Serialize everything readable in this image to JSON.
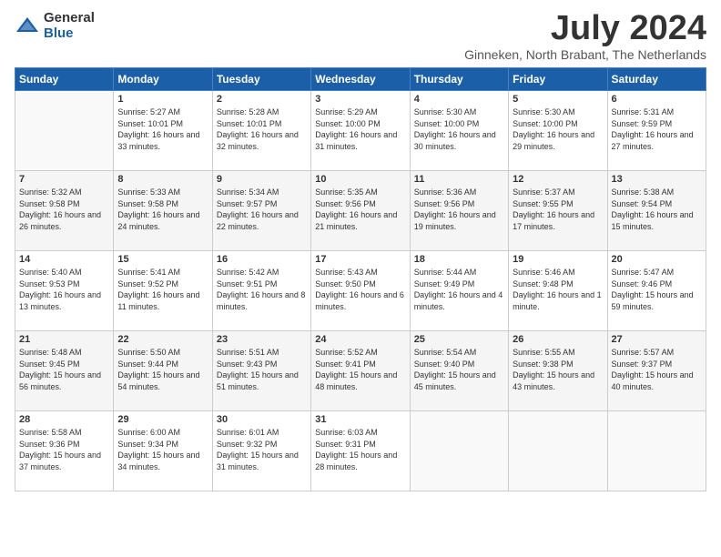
{
  "logo": {
    "general": "General",
    "blue": "Blue"
  },
  "title": "July 2024",
  "subtitle": "Ginneken, North Brabant, The Netherlands",
  "days_of_week": [
    "Sunday",
    "Monday",
    "Tuesday",
    "Wednesday",
    "Thursday",
    "Friday",
    "Saturday"
  ],
  "weeks": [
    [
      {
        "day": "",
        "sunrise": "",
        "sunset": "",
        "daylight": ""
      },
      {
        "day": "1",
        "sunrise": "Sunrise: 5:27 AM",
        "sunset": "Sunset: 10:01 PM",
        "daylight": "Daylight: 16 hours and 33 minutes."
      },
      {
        "day": "2",
        "sunrise": "Sunrise: 5:28 AM",
        "sunset": "Sunset: 10:01 PM",
        "daylight": "Daylight: 16 hours and 32 minutes."
      },
      {
        "day": "3",
        "sunrise": "Sunrise: 5:29 AM",
        "sunset": "Sunset: 10:00 PM",
        "daylight": "Daylight: 16 hours and 31 minutes."
      },
      {
        "day": "4",
        "sunrise": "Sunrise: 5:30 AM",
        "sunset": "Sunset: 10:00 PM",
        "daylight": "Daylight: 16 hours and 30 minutes."
      },
      {
        "day": "5",
        "sunrise": "Sunrise: 5:30 AM",
        "sunset": "Sunset: 10:00 PM",
        "daylight": "Daylight: 16 hours and 29 minutes."
      },
      {
        "day": "6",
        "sunrise": "Sunrise: 5:31 AM",
        "sunset": "Sunset: 9:59 PM",
        "daylight": "Daylight: 16 hours and 27 minutes."
      }
    ],
    [
      {
        "day": "7",
        "sunrise": "Sunrise: 5:32 AM",
        "sunset": "Sunset: 9:58 PM",
        "daylight": "Daylight: 16 hours and 26 minutes."
      },
      {
        "day": "8",
        "sunrise": "Sunrise: 5:33 AM",
        "sunset": "Sunset: 9:58 PM",
        "daylight": "Daylight: 16 hours and 24 minutes."
      },
      {
        "day": "9",
        "sunrise": "Sunrise: 5:34 AM",
        "sunset": "Sunset: 9:57 PM",
        "daylight": "Daylight: 16 hours and 22 minutes."
      },
      {
        "day": "10",
        "sunrise": "Sunrise: 5:35 AM",
        "sunset": "Sunset: 9:56 PM",
        "daylight": "Daylight: 16 hours and 21 minutes."
      },
      {
        "day": "11",
        "sunrise": "Sunrise: 5:36 AM",
        "sunset": "Sunset: 9:56 PM",
        "daylight": "Daylight: 16 hours and 19 minutes."
      },
      {
        "day": "12",
        "sunrise": "Sunrise: 5:37 AM",
        "sunset": "Sunset: 9:55 PM",
        "daylight": "Daylight: 16 hours and 17 minutes."
      },
      {
        "day": "13",
        "sunrise": "Sunrise: 5:38 AM",
        "sunset": "Sunset: 9:54 PM",
        "daylight": "Daylight: 16 hours and 15 minutes."
      }
    ],
    [
      {
        "day": "14",
        "sunrise": "Sunrise: 5:40 AM",
        "sunset": "Sunset: 9:53 PM",
        "daylight": "Daylight: 16 hours and 13 minutes."
      },
      {
        "day": "15",
        "sunrise": "Sunrise: 5:41 AM",
        "sunset": "Sunset: 9:52 PM",
        "daylight": "Daylight: 16 hours and 11 minutes."
      },
      {
        "day": "16",
        "sunrise": "Sunrise: 5:42 AM",
        "sunset": "Sunset: 9:51 PM",
        "daylight": "Daylight: 16 hours and 8 minutes."
      },
      {
        "day": "17",
        "sunrise": "Sunrise: 5:43 AM",
        "sunset": "Sunset: 9:50 PM",
        "daylight": "Daylight: 16 hours and 6 minutes."
      },
      {
        "day": "18",
        "sunrise": "Sunrise: 5:44 AM",
        "sunset": "Sunset: 9:49 PM",
        "daylight": "Daylight: 16 hours and 4 minutes."
      },
      {
        "day": "19",
        "sunrise": "Sunrise: 5:46 AM",
        "sunset": "Sunset: 9:48 PM",
        "daylight": "Daylight: 16 hours and 1 minute."
      },
      {
        "day": "20",
        "sunrise": "Sunrise: 5:47 AM",
        "sunset": "Sunset: 9:46 PM",
        "daylight": "Daylight: 15 hours and 59 minutes."
      }
    ],
    [
      {
        "day": "21",
        "sunrise": "Sunrise: 5:48 AM",
        "sunset": "Sunset: 9:45 PM",
        "daylight": "Daylight: 15 hours and 56 minutes."
      },
      {
        "day": "22",
        "sunrise": "Sunrise: 5:50 AM",
        "sunset": "Sunset: 9:44 PM",
        "daylight": "Daylight: 15 hours and 54 minutes."
      },
      {
        "day": "23",
        "sunrise": "Sunrise: 5:51 AM",
        "sunset": "Sunset: 9:43 PM",
        "daylight": "Daylight: 15 hours and 51 minutes."
      },
      {
        "day": "24",
        "sunrise": "Sunrise: 5:52 AM",
        "sunset": "Sunset: 9:41 PM",
        "daylight": "Daylight: 15 hours and 48 minutes."
      },
      {
        "day": "25",
        "sunrise": "Sunrise: 5:54 AM",
        "sunset": "Sunset: 9:40 PM",
        "daylight": "Daylight: 15 hours and 45 minutes."
      },
      {
        "day": "26",
        "sunrise": "Sunrise: 5:55 AM",
        "sunset": "Sunset: 9:38 PM",
        "daylight": "Daylight: 15 hours and 43 minutes."
      },
      {
        "day": "27",
        "sunrise": "Sunrise: 5:57 AM",
        "sunset": "Sunset: 9:37 PM",
        "daylight": "Daylight: 15 hours and 40 minutes."
      }
    ],
    [
      {
        "day": "28",
        "sunrise": "Sunrise: 5:58 AM",
        "sunset": "Sunset: 9:36 PM",
        "daylight": "Daylight: 15 hours and 37 minutes."
      },
      {
        "day": "29",
        "sunrise": "Sunrise: 6:00 AM",
        "sunset": "Sunset: 9:34 PM",
        "daylight": "Daylight: 15 hours and 34 minutes."
      },
      {
        "day": "30",
        "sunrise": "Sunrise: 6:01 AM",
        "sunset": "Sunset: 9:32 PM",
        "daylight": "Daylight: 15 hours and 31 minutes."
      },
      {
        "day": "31",
        "sunrise": "Sunrise: 6:03 AM",
        "sunset": "Sunset: 9:31 PM",
        "daylight": "Daylight: 15 hours and 28 minutes."
      },
      {
        "day": "",
        "sunrise": "",
        "sunset": "",
        "daylight": ""
      },
      {
        "day": "",
        "sunrise": "",
        "sunset": "",
        "daylight": ""
      },
      {
        "day": "",
        "sunrise": "",
        "sunset": "",
        "daylight": ""
      }
    ]
  ]
}
